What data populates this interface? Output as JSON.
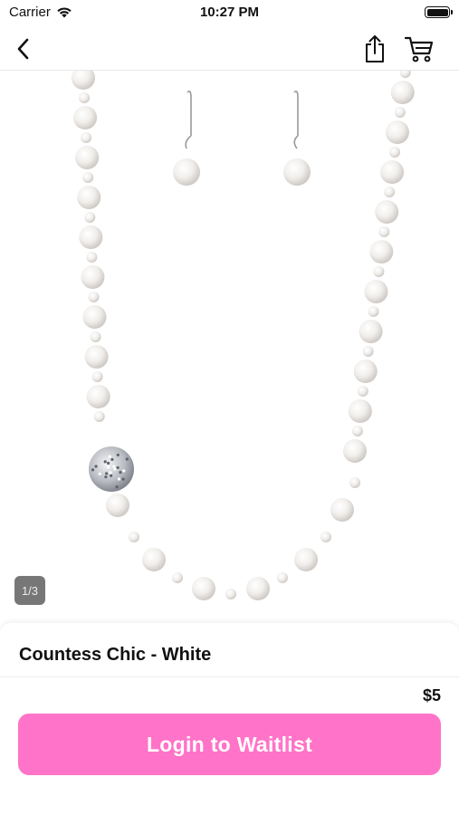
{
  "status_bar": {
    "carrier": "Carrier",
    "time": "10:27 PM",
    "battery_level": 1.0
  },
  "nav": {
    "back_icon": "chevron-left-icon",
    "share_icon": "share-icon",
    "cart_icon": "cart-icon"
  },
  "gallery": {
    "page_indicator": "1/3"
  },
  "product": {
    "title": "Countess Chic - White",
    "price": "$5"
  },
  "actions": {
    "waitlist_label": "Login to Waitlist"
  },
  "colors": {
    "accent": "#ff73c8",
    "indicator_bg": "#777777"
  }
}
